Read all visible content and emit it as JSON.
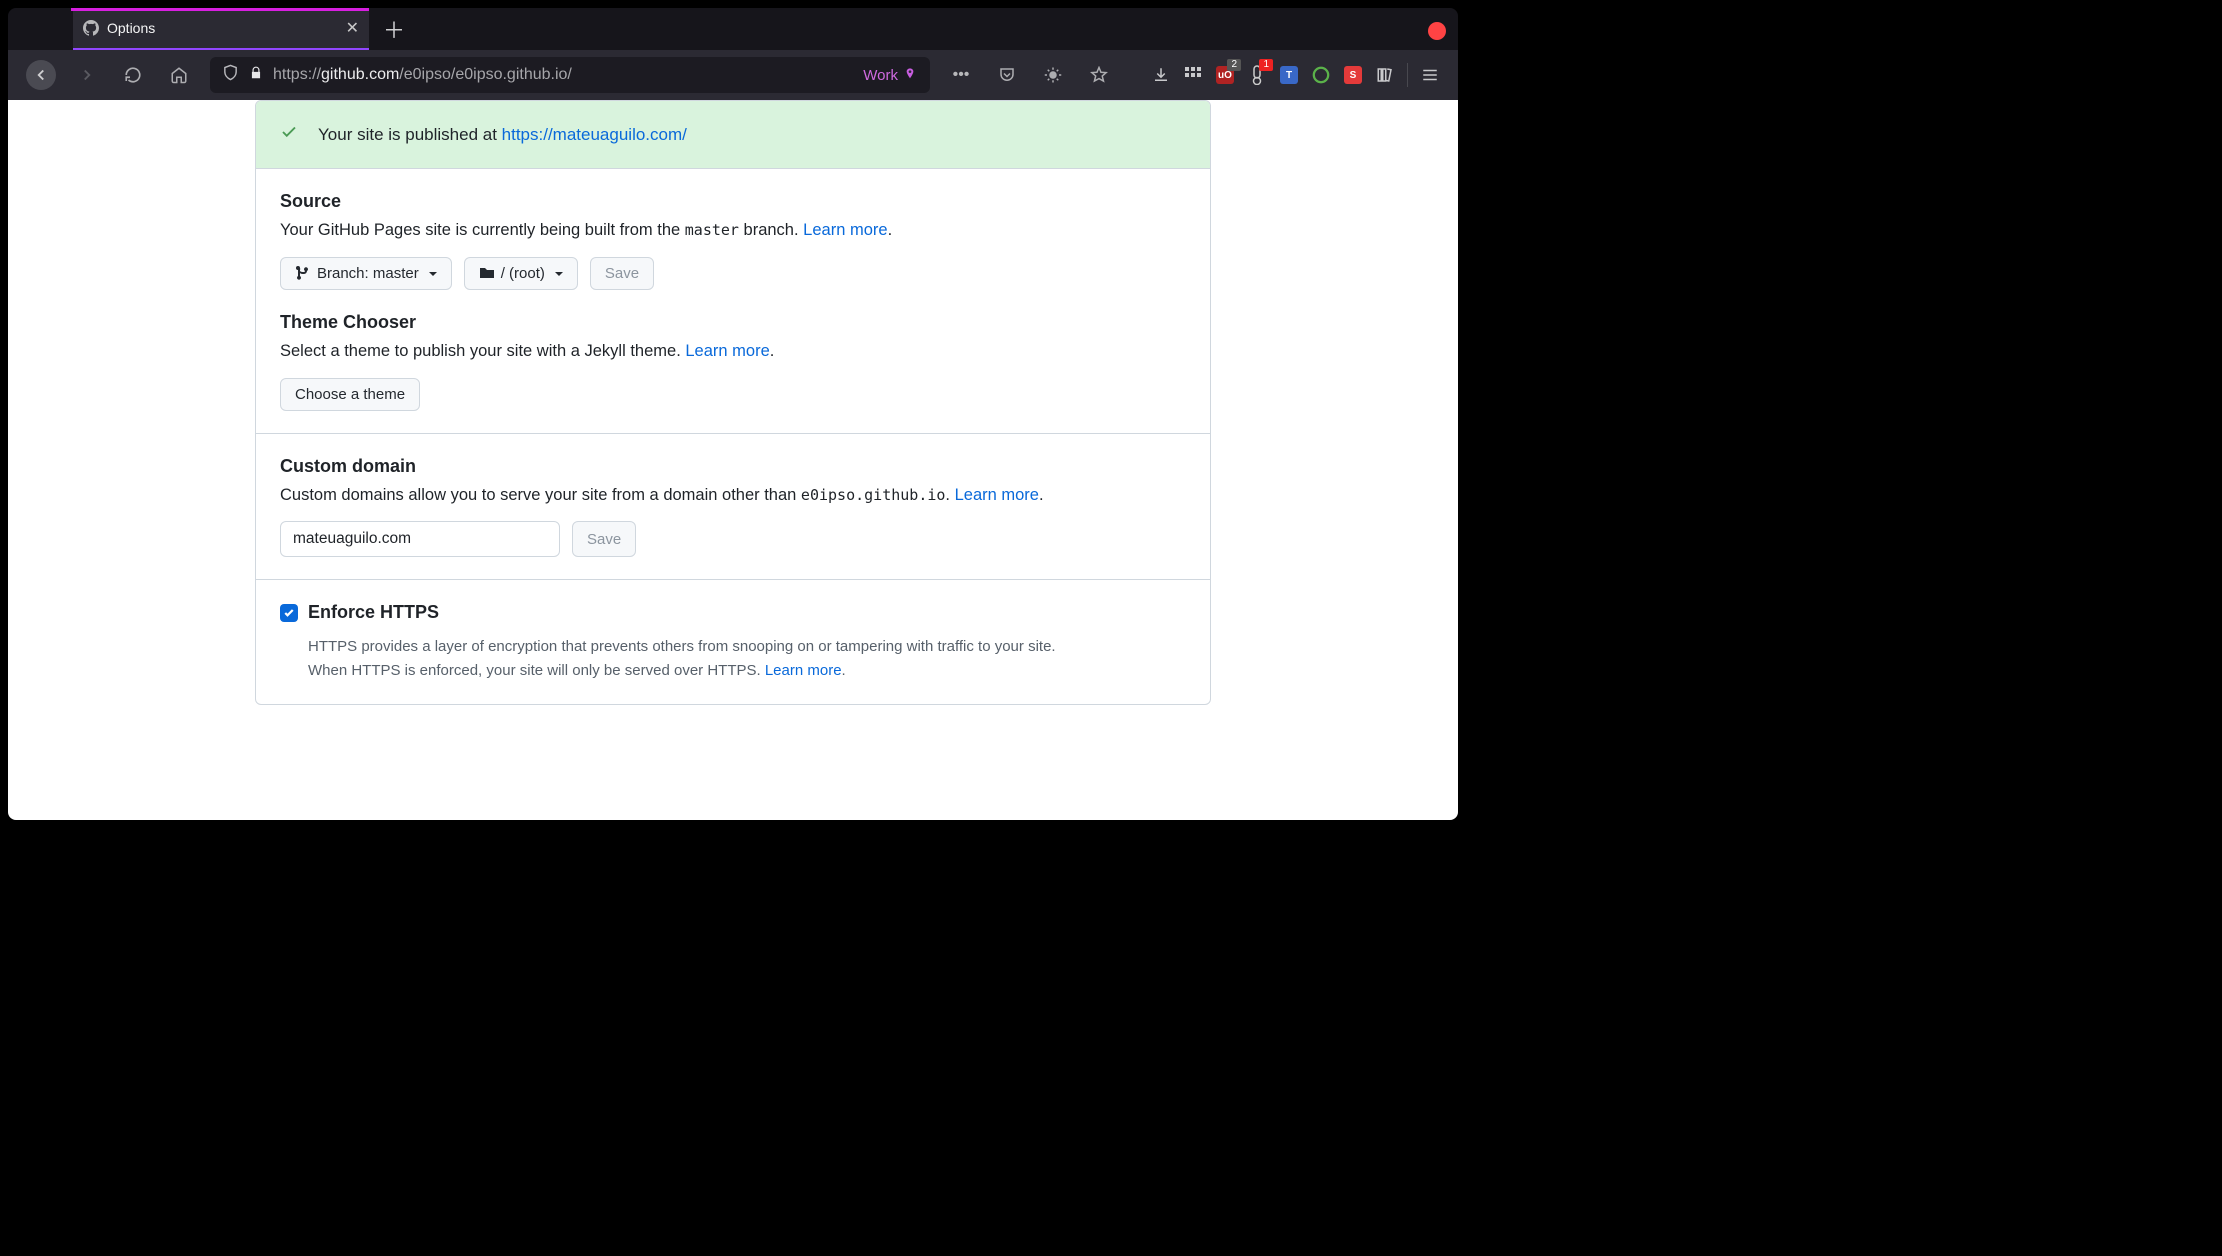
{
  "browser": {
    "tab_title": "Options",
    "url_scheme": "https://",
    "url_host": "github.com",
    "url_path": "/e0ipso/e0ipso.github.io/",
    "container_label": "Work",
    "badge1": "2",
    "badge2": "1"
  },
  "notice": {
    "prefix": "Your site is published at ",
    "link": "https://mateuaguilo.com/"
  },
  "source": {
    "heading": "Source",
    "desc_before": "Your GitHub Pages site is currently being built from the ",
    "desc_code": "master",
    "desc_after": " branch. ",
    "learn_more": "Learn more",
    "branch_label": "Branch: ",
    "branch_name": "master",
    "folder_label": "/ (root)",
    "save": "Save"
  },
  "theme": {
    "heading": "Theme Chooser",
    "desc": "Select a theme to publish your site with a Jekyll theme. ",
    "learn_more": "Learn more",
    "button": "Choose a theme"
  },
  "domain": {
    "heading": "Custom domain",
    "desc_before": "Custom domains allow you to serve your site from a domain other than ",
    "desc_code": "e0ipso.github.io",
    "desc_after": ". ",
    "learn_more": "Learn more",
    "input_value": "mateuaguilo.com",
    "save": "Save"
  },
  "https": {
    "heading": "Enforce HTTPS",
    "line1": "HTTPS provides a layer of encryption that prevents others from snooping on or tampering with traffic to your site.",
    "line2_before": "When HTTPS is enforced, your site will only be served over HTTPS. ",
    "learn_more": "Learn more"
  }
}
